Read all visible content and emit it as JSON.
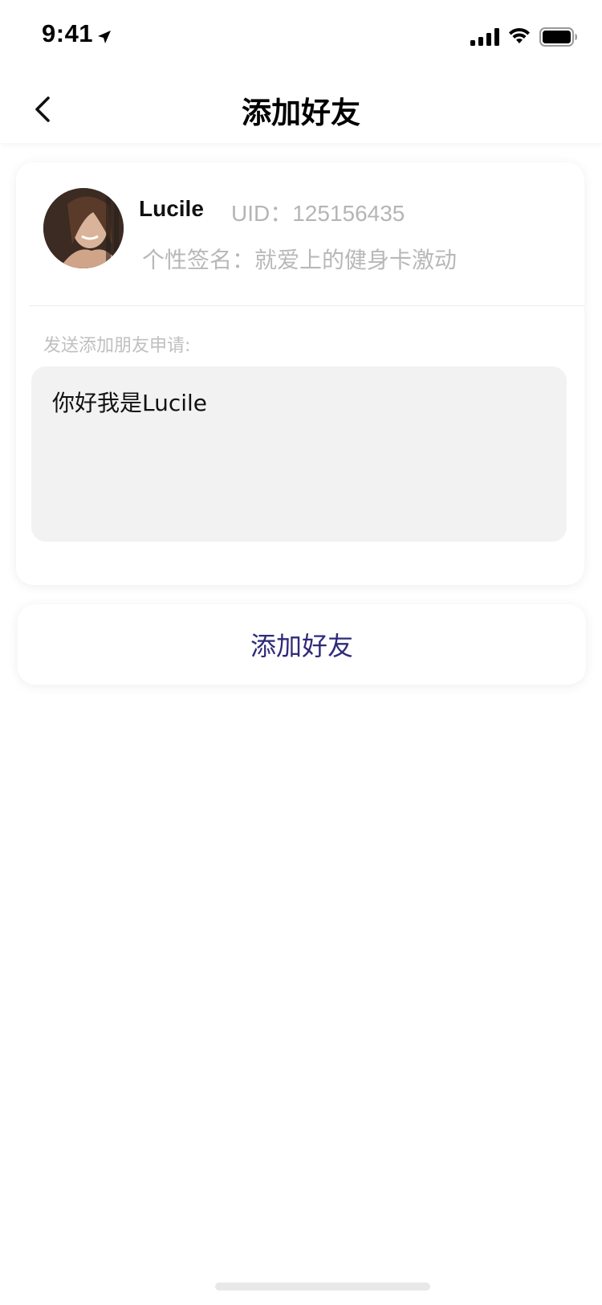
{
  "status_bar": {
    "time": "9:41",
    "icons": [
      "location-arrow-icon",
      "cellular-signal-icon",
      "wifi-icon",
      "battery-icon"
    ]
  },
  "nav": {
    "title": "添加好友",
    "back_icon": "chevron-left-icon"
  },
  "profile": {
    "name": "Lucile",
    "uid": "UID：125156435",
    "signature": "个性签名：就爱上的健身卡激动"
  },
  "request": {
    "label": "发送添加朋友申请:",
    "message": "你好我是Lucile"
  },
  "actions": {
    "add_friend_label": "添加好友"
  },
  "colors": {
    "accent": "#2e2a7a",
    "muted_text": "#b5b5b5",
    "input_bg": "#f2f2f2"
  }
}
